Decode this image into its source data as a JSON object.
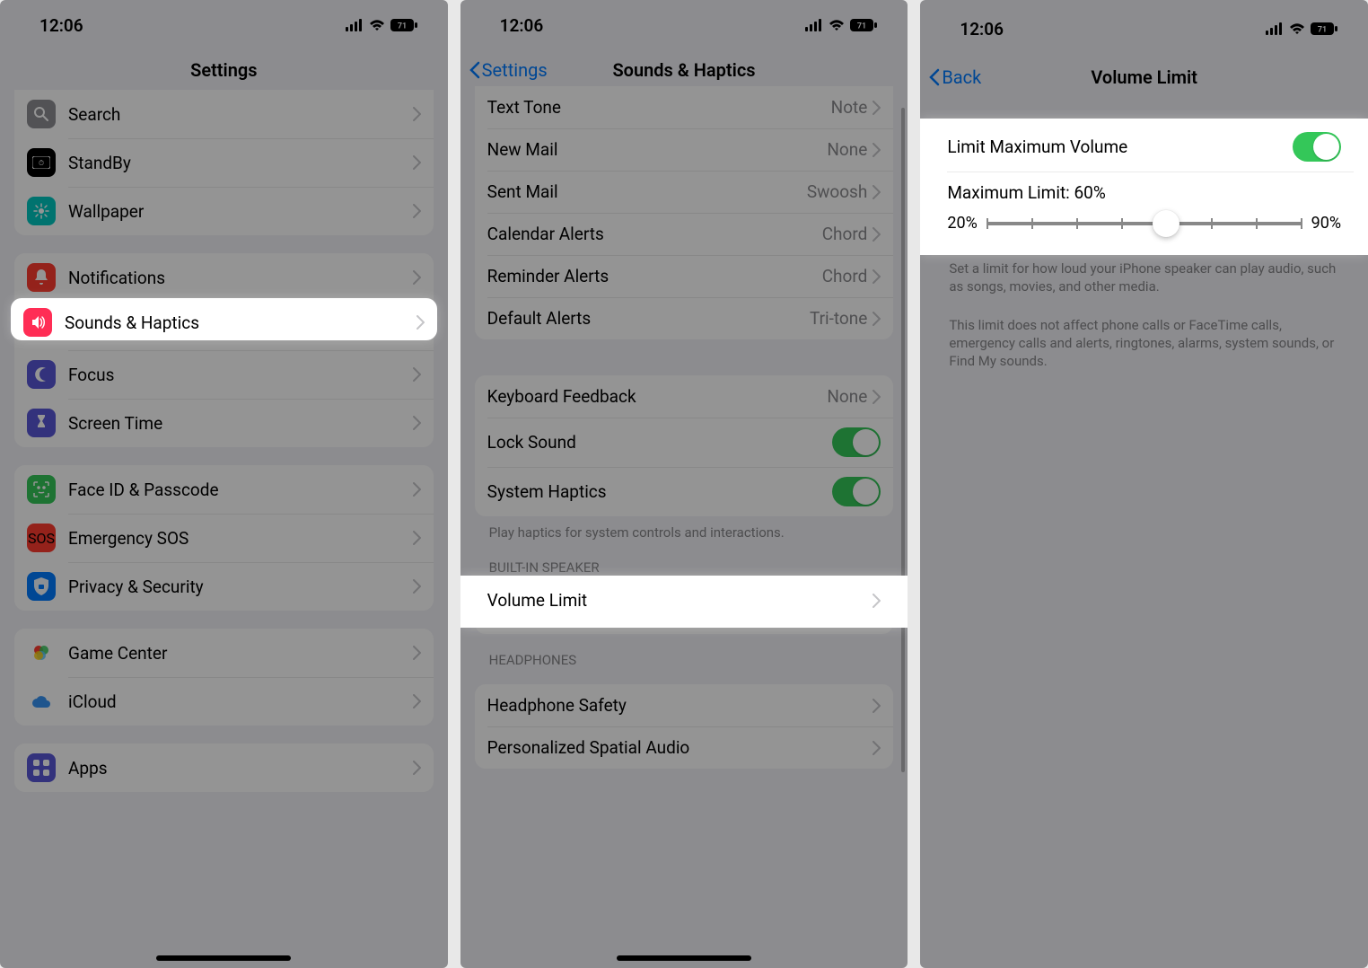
{
  "status": {
    "time": "12:06",
    "battery": "71"
  },
  "screen1": {
    "title": "Settings",
    "groups": [
      {
        "rows": [
          {
            "icon": "search-icon",
            "label": "Search",
            "color": "#8e8e93"
          },
          {
            "icon": "standby-icon",
            "label": "StandBy",
            "color": "#000"
          },
          {
            "icon": "wallpaper-icon",
            "label": "Wallpaper",
            "color": "#00c7c0"
          }
        ]
      },
      {
        "rows": [
          {
            "icon": "notifications-icon",
            "label": "Notifications",
            "color": "#ff3b30"
          },
          {
            "icon": "sounds-icon",
            "label": "Sounds & Haptics",
            "color": "#ff2d55",
            "hl": true
          },
          {
            "icon": "focus-icon",
            "label": "Focus",
            "color": "#5856d6"
          },
          {
            "icon": "screentime-icon",
            "label": "Screen Time",
            "color": "#5856d6"
          }
        ]
      },
      {
        "rows": [
          {
            "icon": "faceid-icon",
            "label": "Face ID & Passcode",
            "color": "#34c759"
          },
          {
            "icon": "sos-icon",
            "label": "Emergency SOS",
            "color": "#ff3b30"
          },
          {
            "icon": "privacy-icon",
            "label": "Privacy & Security",
            "color": "#007aff"
          }
        ]
      },
      {
        "rows": [
          {
            "icon": "gamecenter-icon",
            "label": "Game Center",
            "color": "#fff"
          },
          {
            "icon": "icloud-icon",
            "label": "iCloud",
            "color": "#fff"
          }
        ]
      },
      {
        "rows": [
          {
            "icon": "apps-icon",
            "label": "Apps",
            "color": "#5856d6"
          }
        ]
      }
    ]
  },
  "screen2": {
    "back": "Settings",
    "title": "Sounds & Haptics",
    "tones": [
      {
        "label": "Text Tone",
        "value": "Note"
      },
      {
        "label": "New Mail",
        "value": "None"
      },
      {
        "label": "Sent Mail",
        "value": "Swoosh"
      },
      {
        "label": "Calendar Alerts",
        "value": "Chord"
      },
      {
        "label": "Reminder Alerts",
        "value": "Chord"
      },
      {
        "label": "Default Alerts",
        "value": "Tri-tone"
      }
    ],
    "feedback": {
      "keyboard_label": "Keyboard Feedback",
      "keyboard_value": "None",
      "lock_label": "Lock Sound",
      "haptics_label": "System Haptics",
      "footer": "Play haptics for system controls and interactions."
    },
    "builtin_header": "BUILT-IN SPEAKER",
    "volume_limit_label": "Volume Limit",
    "headphones_header": "HEADPHONES",
    "headphone_rows": [
      {
        "label": "Headphone Safety"
      },
      {
        "label": "Personalized Spatial Audio"
      }
    ]
  },
  "screen3": {
    "back": "Back",
    "title": "Volume Limit",
    "limit_label": "Limit Maximum Volume",
    "max_label": "Maximum Limit: 60%",
    "min_pct": "20%",
    "max_pct": "90%",
    "thumb_pct": 57,
    "footer1": "Set a limit for how loud your iPhone speaker can play audio, such as songs, movies, and other media.",
    "footer2": "This limit does not affect phone calls or FaceTime calls, emergency calls and alerts, ringtones, alarms, system sounds, or Find My sounds."
  }
}
